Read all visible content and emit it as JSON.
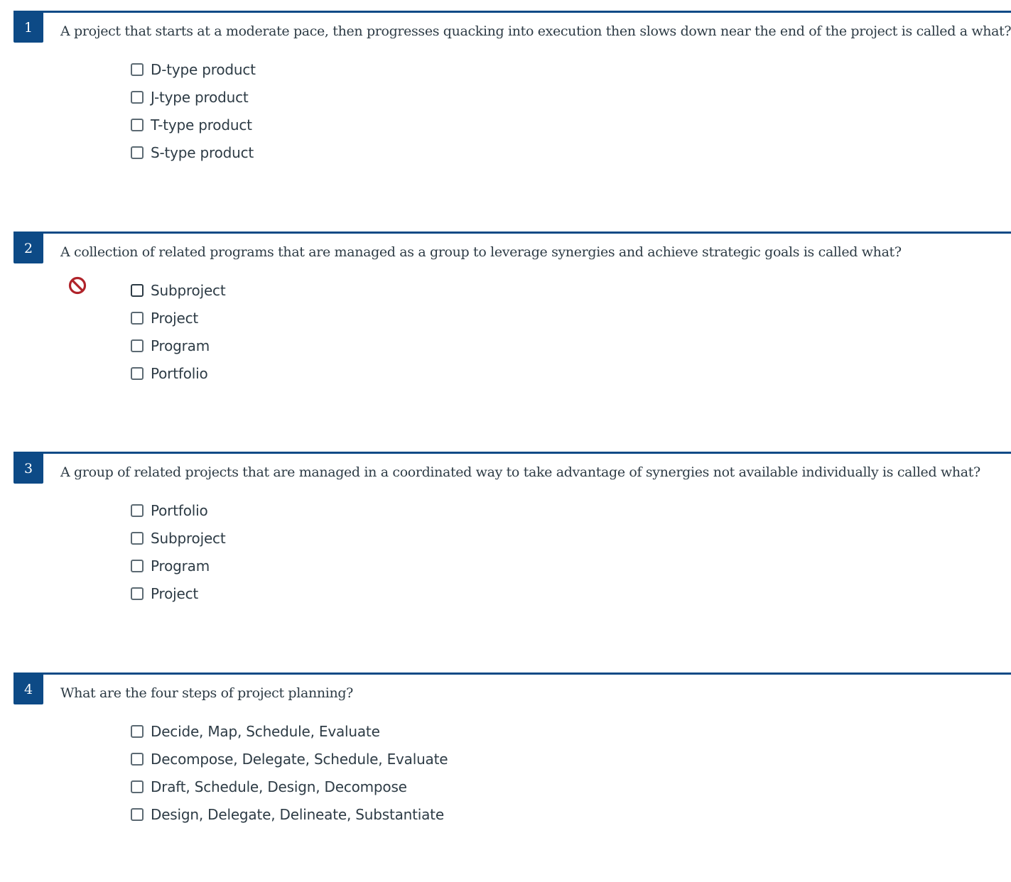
{
  "colors": {
    "accent": "#0d4a86",
    "text": "#2d3b45",
    "checkbox_border": "#5c6a73",
    "incorrect": "#b0232a"
  },
  "questions": [
    {
      "number": "1",
      "text": "A project that starts at a moderate pace, then progresses quacking into execution then slows down near the end of the project is called a what?",
      "answers": [
        "D-type product",
        "J-type product",
        "T-type product",
        "S-type product"
      ]
    },
    {
      "number": "2",
      "text": "A collection of related programs that are managed as a group to leverage synergies and achieve strategic goals is called what?",
      "status_icon": "no-entry-icon",
      "answers": [
        "Subproject",
        "Project",
        "Program",
        "Portfolio"
      ]
    },
    {
      "number": "3",
      "text": "A group of related projects that are managed in a coordinated way to take advantage of synergies not available individually is called what?",
      "answers": [
        "Portfolio",
        "Subproject",
        "Program",
        "Project"
      ]
    },
    {
      "number": "4",
      "text": "What are the four steps of project planning?",
      "answers": [
        "Decide, Map, Schedule, Evaluate",
        "Decompose, Delegate, Schedule, Evaluate",
        "Draft, Schedule, Design, Decompose",
        "Design, Delegate, Delineate, Substantiate"
      ]
    }
  ]
}
